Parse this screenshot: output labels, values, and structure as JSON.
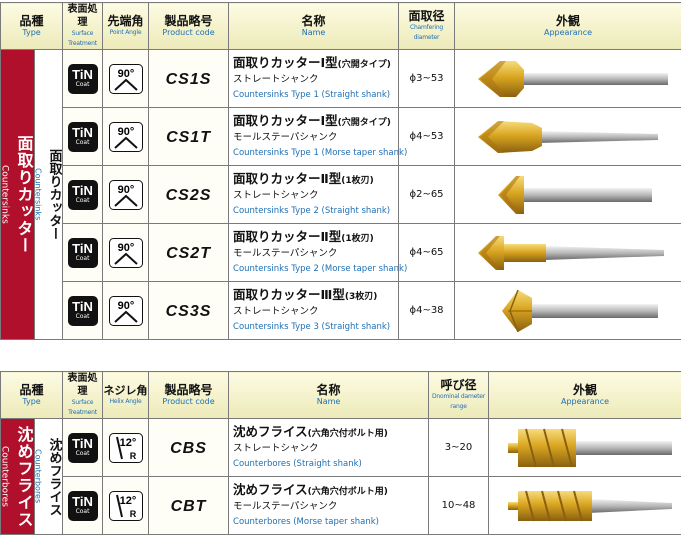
{
  "table1": {
    "headers": {
      "type_jp": "品種",
      "type_en": "Type",
      "surface_jp": "表面処理",
      "surface_en": "Surface Treatment",
      "angle_jp": "先端角",
      "angle_en": "Point Angle",
      "code_jp": "製品略号",
      "code_en": "Product code",
      "name_jp": "名称",
      "name_en": "Name",
      "dia_jp": "面取径",
      "dia_en": "Chamfering diameter",
      "appearance_jp": "外観",
      "appearance_en": "Appearance"
    },
    "type_main_jp": "面取りカッター",
    "type_main_en": "Countersinks",
    "type_sub_jp": "面取りカッター",
    "type_sub_en": "Countersinks",
    "rows": [
      {
        "coating": "TiN",
        "coating_sub": "Coat",
        "angle": "90°",
        "code": "CS1S",
        "name_jp": "面取りカッターⅠ型",
        "name_note": "(穴開タイプ)",
        "shank_jp": "ストレートシャンク",
        "name_en": "Countersinks Type 1 (Straight shank)",
        "diameter": "ϕ3~53"
      },
      {
        "coating": "TiN",
        "coating_sub": "Coat",
        "angle": "90°",
        "code": "CS1T",
        "name_jp": "面取りカッターⅠ型",
        "name_note": "(穴開タイプ)",
        "shank_jp": "モールステーパシャンク",
        "name_en": "Countersinks Type 1 (Morse taper shank)",
        "diameter": "ϕ4~53"
      },
      {
        "coating": "TiN",
        "coating_sub": "Coat",
        "angle": "90°",
        "code": "CS2S",
        "name_jp": "面取りカッターⅡ型",
        "name_note": "(1枚刃)",
        "shank_jp": "ストレートシャンク",
        "name_en": "Countersinks Type 2 (Straight shank)",
        "diameter": "ϕ2~65"
      },
      {
        "coating": "TiN",
        "coating_sub": "Coat",
        "angle": "90°",
        "code": "CS2T",
        "name_jp": "面取りカッターⅡ型",
        "name_note": "(1枚刃)",
        "shank_jp": "モールステーパシャンク",
        "name_en": "Countersinks Type 2 (Morse taper shank)",
        "diameter": "ϕ4~65"
      },
      {
        "coating": "TiN",
        "coating_sub": "Coat",
        "angle": "90°",
        "code": "CS3S",
        "name_jp": "面取りカッターⅢ型",
        "name_note": "(3枚刃)",
        "shank_jp": "ストレートシャンク",
        "name_en": "Countersinks Type 3 (Straight shank)",
        "diameter": "ϕ4~38"
      }
    ]
  },
  "table2": {
    "headers": {
      "type_jp": "品種",
      "type_en": "Type",
      "surface_jp": "表面処理",
      "surface_en": "Surface Treatment",
      "angle_jp": "ネジレ角",
      "angle_en": "Helix Angle",
      "code_jp": "製品略号",
      "code_en": "Product code",
      "name_jp": "名称",
      "name_en": "Name",
      "dia_jp": "呼び径",
      "dia_en": "Dnominal dameter range",
      "appearance_jp": "外観",
      "appearance_en": "Appearance"
    },
    "type_main_jp": "沈めフライス",
    "type_main_en": "Counterbores",
    "type_sub_jp": "沈めフライス",
    "type_sub_en": "Counterbores",
    "rows": [
      {
        "coating": "TiN",
        "coating_sub": "Coat",
        "angle": "12°",
        "angle_sub": "R",
        "code": "CBS",
        "name_jp": "沈めフライス",
        "name_note": "(六角穴付ボルト用)",
        "shank_jp": "ストレートシャンク",
        "name_en": "Counterbores (Straight shank)",
        "diameter": "3~20"
      },
      {
        "coating": "TiN",
        "coating_sub": "Coat",
        "angle": "12°",
        "angle_sub": "R",
        "code": "CBT",
        "name_jp": "沈めフライス",
        "name_note": "(六角穴付ボルト用)",
        "shank_jp": "モールステーパシャンク",
        "name_en": "Counterbores (Morse taper shank)",
        "diameter": "10~48"
      }
    ]
  },
  "colors": {
    "accent_red": "#b0102b",
    "header_bg": "#f3f1c8",
    "english_text": "#1f6fb5",
    "gold": "#d9a520"
  },
  "icons": [
    "tin-coat-badge",
    "point-angle-90-icon",
    "helix-angle-12-icon",
    "countersink-tool-image",
    "counterbore-tool-image"
  ]
}
